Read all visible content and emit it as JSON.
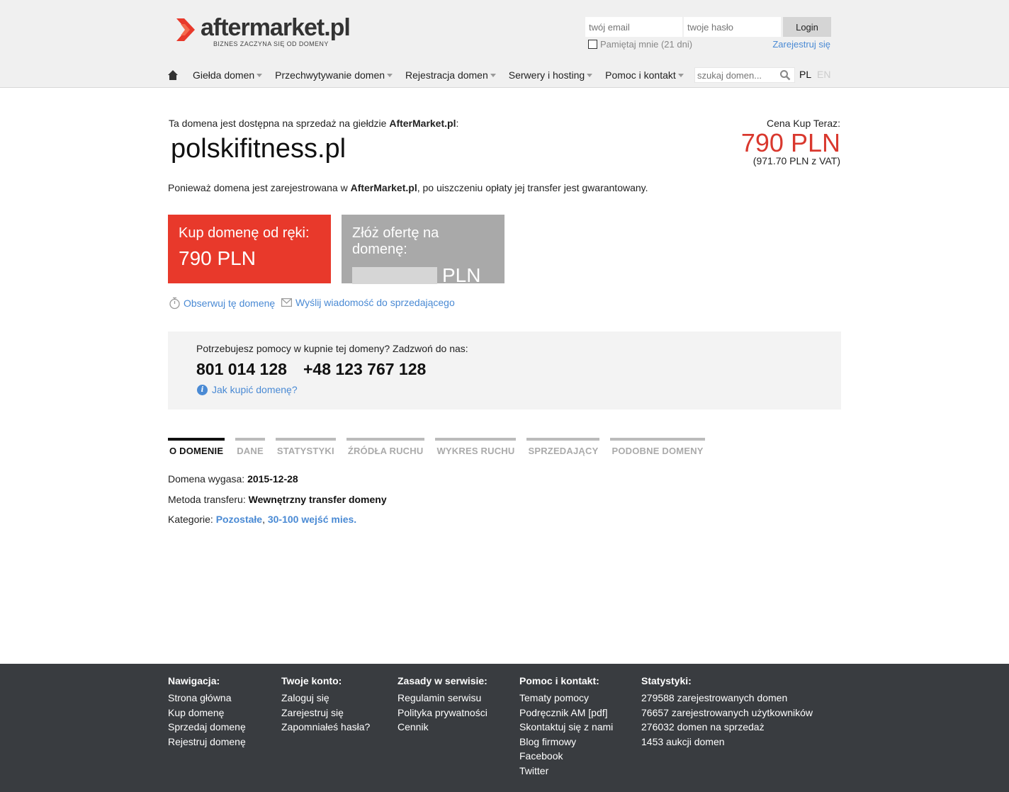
{
  "header": {
    "logo_text": "aftermarket.pl",
    "logo_tagline": "BIZNES ZACZYNA SIĘ OD DOMENY",
    "email_placeholder": "twój email",
    "password_placeholder": "twoje hasło",
    "login_label": "Login",
    "remember_label": "Pamiętaj mnie (21 dni)",
    "register_label": "Zarejestruj się"
  },
  "nav": {
    "items": [
      {
        "label": "Giełda domen"
      },
      {
        "label": "Przechwytywanie domen"
      },
      {
        "label": "Rejestracja domen"
      },
      {
        "label": "Serwery i hosting"
      },
      {
        "label": "Pomoc i kontakt"
      }
    ],
    "search_placeholder": "szukaj domen...",
    "lang_pl": "PL",
    "lang_en": "EN"
  },
  "main": {
    "avail_prefix": "Ta domena jest dostępna na sprzedaż na giełdzie ",
    "avail_brand": "AfterMarket.pl",
    "avail_suffix": ":",
    "domain": "polskifitness.pl",
    "price_label": "Cena Kup Teraz:",
    "price": "790 PLN",
    "price_vat": "(971.70 PLN z VAT)",
    "transfer_prefix": "Ponieważ domena jest zarejestrowana w ",
    "transfer_brand": "AfterMarket.pl",
    "transfer_suffix": ", po uiszczeniu opłaty jej transfer jest gwarantowany.",
    "buy_title": "Kup domenę od ręki:",
    "buy_price": "790 PLN",
    "offer_title": "Złóż ofertę na domenę:",
    "offer_currency": "PLN",
    "watch_label": "Obserwuj tę domenę",
    "message_label": "Wyślij wiadomość do sprzedającego"
  },
  "help": {
    "question": "Potrzebujesz pomocy w kupnie tej domeny? Zadzwoń do nas:",
    "phone1": "801 014 128",
    "phone2": "+48 123 767 128",
    "how_to_buy": "Jak kupić domenę?"
  },
  "tabs": [
    {
      "label": "O DOMENIE"
    },
    {
      "label": "DANE"
    },
    {
      "label": "STATYSTYKI"
    },
    {
      "label": "ŹRÓDŁA RUCHU"
    },
    {
      "label": "WYKRES RUCHU"
    },
    {
      "label": "SPRZEDAJĄCY"
    },
    {
      "label": "PODOBNE DOMENY"
    }
  ],
  "details": {
    "expires_label": "Domena wygasa: ",
    "expires_value": "2015-12-28",
    "method_label": "Metoda transferu: ",
    "method_value": "Wewnętrzny transfer domeny",
    "categories_label": "Kategorie: ",
    "category1": "Pozostałe",
    "category_sep": ", ",
    "category2": "30-100 wejść mies."
  },
  "footer": {
    "nav": {
      "title": "Nawigacja:",
      "links": [
        "Strona główna",
        "Kup domenę",
        "Sprzedaj domenę",
        "Rejestruj domenę"
      ]
    },
    "account": {
      "title": "Twoje konto:",
      "links": [
        "Zaloguj się",
        "Zarejestruj się",
        "Zapomniałeś hasła?"
      ]
    },
    "rules": {
      "title": "Zasady w serwisie:",
      "links": [
        "Regulamin serwisu",
        "Polityka prywatności",
        "Cennik"
      ]
    },
    "help": {
      "title": "Pomoc i kontakt:",
      "links": [
        "Tematy pomocy",
        "Podręcznik AM [pdf]",
        "Skontaktuj się z nami",
        "Blog firmowy",
        "Facebook",
        "Twitter"
      ]
    },
    "stats": {
      "title": "Statystyki:",
      "lines": [
        "279588 zarejestrowanych domen",
        "76657 zarejestrowanych użytkowników",
        "276032 domen na sprzedaż",
        "1453 aukcji domen"
      ]
    }
  },
  "colors": {
    "accent_red": "#e8392b",
    "link_blue": "#4a8ad4",
    "footer_bg": "#393c40"
  }
}
